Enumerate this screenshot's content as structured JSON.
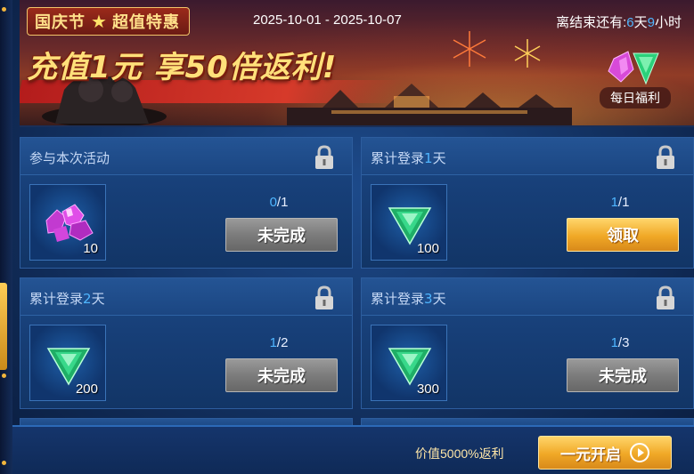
{
  "banner": {
    "tag_part1": "国庆节",
    "tag_part2": "超值特惠",
    "date_range": "2025-10-01 - 2025-10-07",
    "headline": "充值1元 享50倍返利!",
    "countdown_prefix": "离结束还有:",
    "countdown_days": "6",
    "countdown_days_unit": "天",
    "countdown_hours": "9",
    "countdown_hours_unit": "小时",
    "daily_gift_label": "每日福利"
  },
  "cards": [
    {
      "title_pre": "参与本次活动",
      "title_hl": "",
      "title_post": "",
      "item": "purple-crystal",
      "qty": "10",
      "progress_cur": "0",
      "progress_total": "/1",
      "button": "未完成",
      "button_style": "gray"
    },
    {
      "title_pre": "累计登录",
      "title_hl": "1",
      "title_post": "天",
      "item": "green-gem",
      "qty": "100",
      "progress_cur": "1",
      "progress_total": "/1",
      "button": "领取",
      "button_style": "gold"
    },
    {
      "title_pre": "累计登录",
      "title_hl": "2",
      "title_post": "天",
      "item": "green-gem",
      "qty": "200",
      "progress_cur": "1",
      "progress_total": "/2",
      "button": "未完成",
      "button_style": "gray"
    },
    {
      "title_pre": "累计登录",
      "title_hl": "3",
      "title_post": "天",
      "item": "green-gem",
      "qty": "300",
      "progress_cur": "1",
      "progress_total": "/3",
      "button": "未完成",
      "button_style": "gray"
    }
  ],
  "bottom_bar": {
    "value_text": "价值5000%返利",
    "buy_button": "一元开启"
  },
  "colors": {
    "highlight_blue": "#4fb6ff",
    "gold": "#f0a826",
    "panel_blue": "#173f78"
  }
}
